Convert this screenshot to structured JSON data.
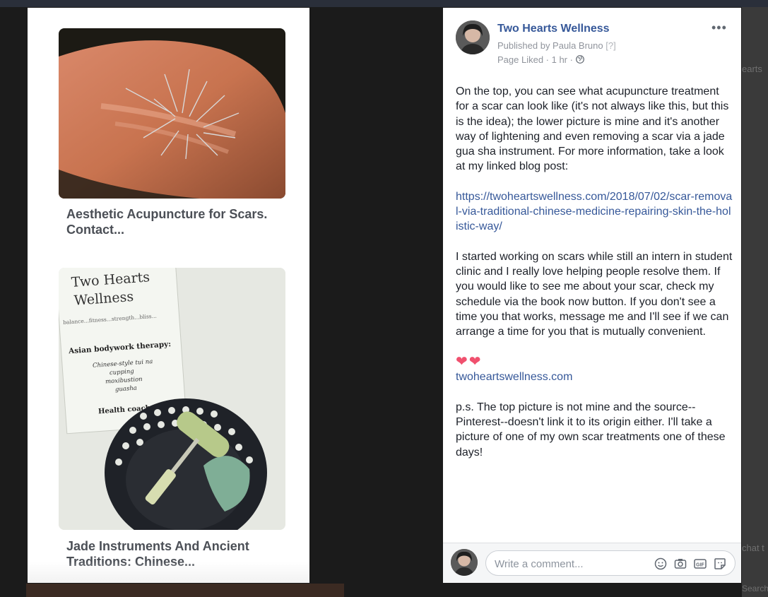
{
  "background": {
    "right_edge_texts": [
      "earts",
      "chat t",
      "Search"
    ]
  },
  "link_previews": [
    {
      "title": "Aesthetic Acupuncture for Scars. Contact..."
    },
    {
      "title": "Jade Instruments And Ancient Traditions: Chinese...",
      "image_texts": {
        "brand_line1": "Two Hearts",
        "brand_line2": "Wellness",
        "tagline": "balance...fitness...strength...bliss...",
        "heading": "Asian bodywork therapy:",
        "items": [
          "Chinese-style tui na",
          "cupping",
          "moxibustion",
          "guasha"
        ],
        "footer": "Health coach"
      }
    }
  ],
  "post": {
    "page_name": "Two Hearts Wellness",
    "published_by": "Published by Paula Bruno",
    "help_marker": "[?]",
    "status_line": "Page Liked · 1 hr ·",
    "more_label": "•••",
    "paragraph1": "On the top, you can see what acupuncture treatment for a scar can look like (it's not always like this, but this is the idea); the lower picture is mine and it's another way of lightening and even removing a scar via a jade gua sha instrument. For more information, take a look at my linked blog post:",
    "blog_link": "https://twoheartswellness.com/2018/07/02/scar-removal-via-traditional-chinese-medicine-repairing-skin-the-holistic-way/",
    "paragraph2": "I started working on scars while still an intern in student clinic and I really love helping people resolve them. If you would like to see me about your scar, check my schedule via the book now button. If you don't see a time you that works, message me and I'll see if we can arrange a time for you that is mutually convenient.",
    "hearts": "❤❤",
    "site_link": "twoheartswellness.com",
    "paragraph3": "p.s. The top picture is not mine and the source--Pinterest--doesn't link it to its origin either. I'll take a picture of one of my own scar treatments one of these days!"
  },
  "comment": {
    "placeholder": "Write a comment...",
    "icons": [
      "emoji-icon",
      "camera-icon",
      "gif-icon",
      "sticker-icon"
    ]
  },
  "colors": {
    "link_blue": "#365899",
    "meta_gray": "#90949c",
    "heart_pink": "#f0506e",
    "text_dark": "#1d2129"
  }
}
